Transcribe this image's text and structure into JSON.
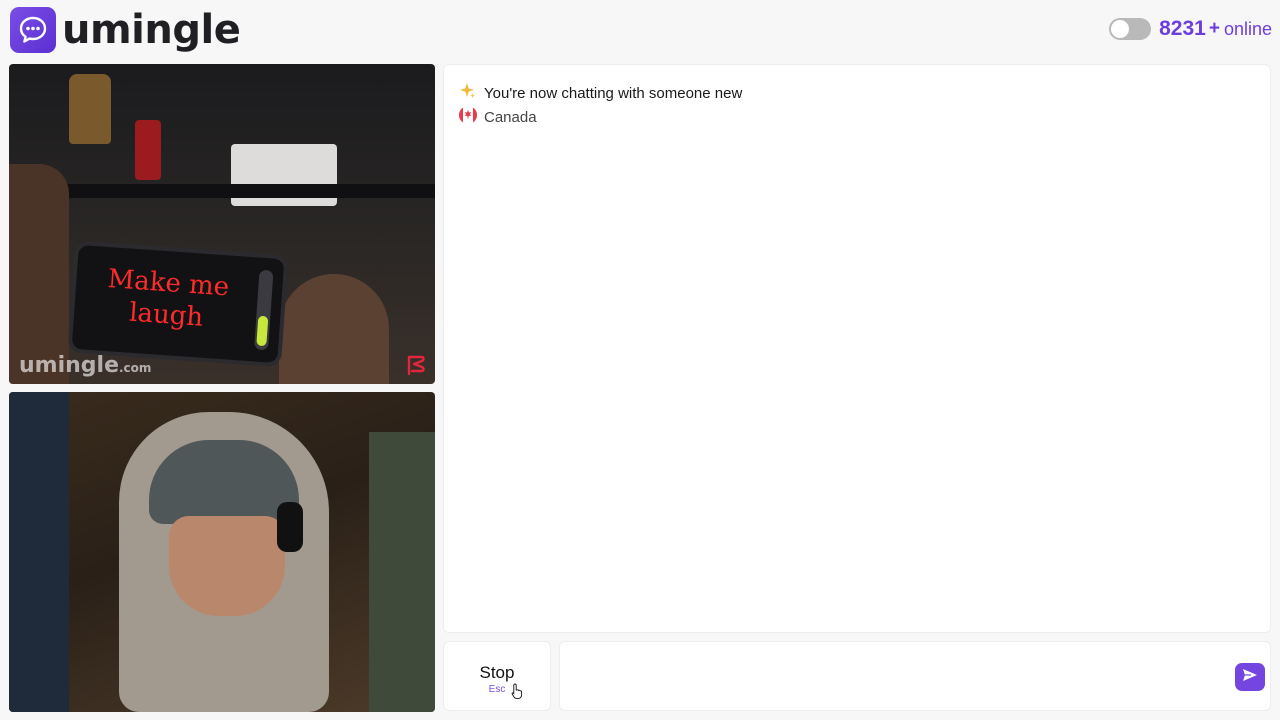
{
  "header": {
    "logo_text": "umingle",
    "online_count": "8231",
    "online_plus": "+",
    "online_label": "online"
  },
  "video_top": {
    "sign_text": "Make me laugh",
    "watermark": "umingle",
    "watermark_suffix": ".com"
  },
  "chat": {
    "title": "You're now chatting with someone new",
    "country": "Canada"
  },
  "controls": {
    "stop_label": "Stop",
    "stop_key": "Esc",
    "message_placeholder": ""
  },
  "colors": {
    "accent": "#6c3ee0",
    "send_button": "#7445e0"
  },
  "icons": {
    "logo": "chat-bubble-icon",
    "title_emoji": "sparkles-icon",
    "country_flag": "canada-flag-icon",
    "send": "send-arrow-icon",
    "report": "flag-icon"
  }
}
